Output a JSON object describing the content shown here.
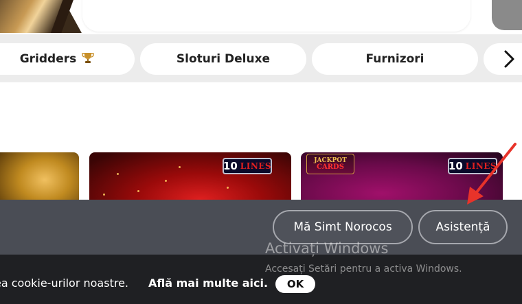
{
  "categories": [
    {
      "label": "Gridders",
      "icon": "trophy-icon"
    },
    {
      "label": "Sloturi Deluxe"
    },
    {
      "label": "Furnizori"
    }
  ],
  "next_icon": "chevron-right-icon",
  "games": [
    {
      "badge_num": "10",
      "badge_word": "LINES"
    },
    {
      "logo_top": "JACKPOT",
      "logo_bottom": "CARDS",
      "badge_num": "10",
      "badge_word": "LINES"
    }
  ],
  "actions": {
    "lucky_label": "Mă Simt Norocos",
    "support_label": "Asistență"
  },
  "cookie": {
    "text": "ea cookie-urilor noastre.",
    "link": "Află mai multe aici.",
    "ok_label": "OK"
  },
  "windows_watermark": {
    "title": "Activați Windows",
    "subtitle": "Accesați Setări pentru a activa Windows."
  },
  "colors": {
    "overlay_band": "#4a4d55",
    "cookie_bar": "#1f2023",
    "annotation_arrow": "#e8332a"
  }
}
